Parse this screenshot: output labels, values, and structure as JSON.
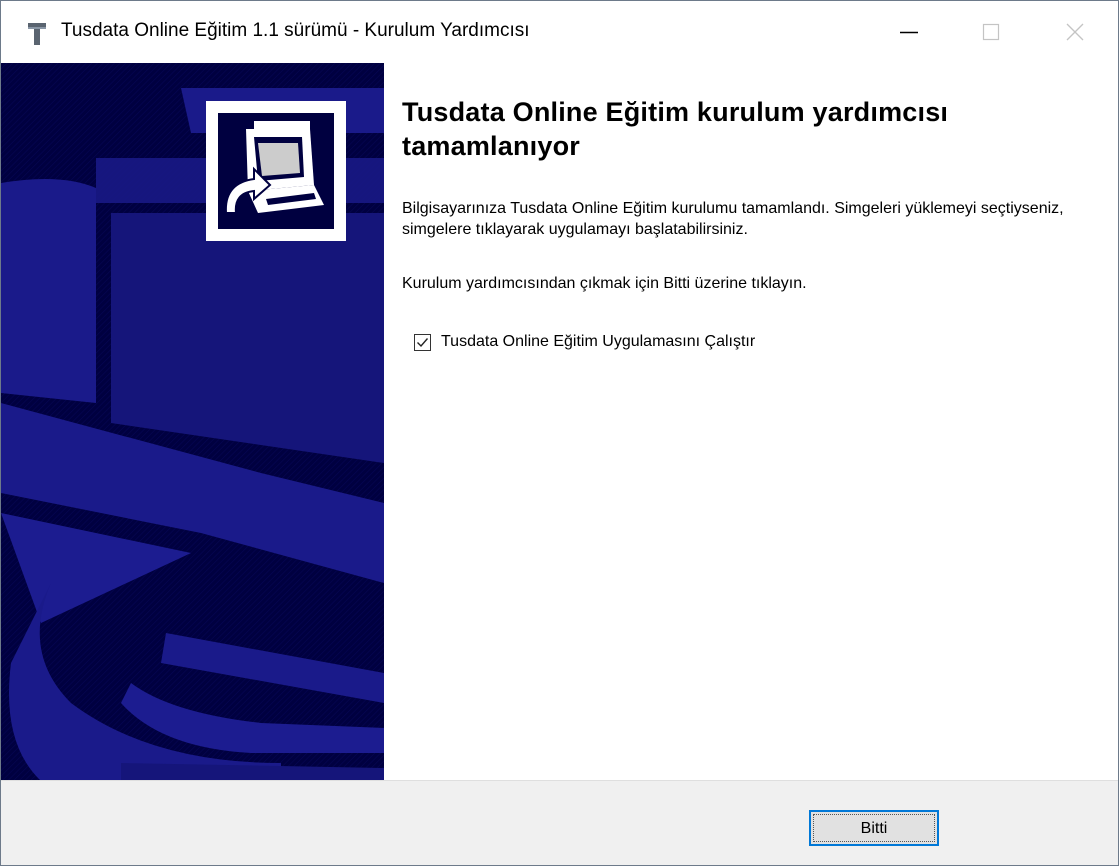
{
  "window": {
    "title": "Tusdata Online Eğitim 1.1 sürümü - Kurulum Yardımcısı",
    "controls": {
      "minimize": "minimize-icon",
      "maximize": "maximize-icon",
      "close": "close-icon"
    }
  },
  "main": {
    "heading": "Tusdata Online Eğitim kurulum yardımcısı tamamlanıyor",
    "paragraph1": "Bilgisayarınıza Tusdata Online Eğitim kurulumu tamamlandı. Simgeleri yüklemeyi seçtiyseniz, simgelere tıklayarak uygulamayı başlatabilirsiniz.",
    "paragraph2": "Kurulum yardımcısından çıkmak için Bitti üzerine tıklayın.",
    "run_app": {
      "label": "Tusdata Online Eğitim Uygulamasını Çalıştır",
      "checked": true
    }
  },
  "footer": {
    "finish_label": "Bitti"
  },
  "colors": {
    "banner": "#000040",
    "banner_art": "#1a1a8a",
    "accent": "#0078d7",
    "footer": "#f0f0f0"
  },
  "icons": [
    "app-icon",
    "setup-computer-icon",
    "checkmark-icon"
  ]
}
